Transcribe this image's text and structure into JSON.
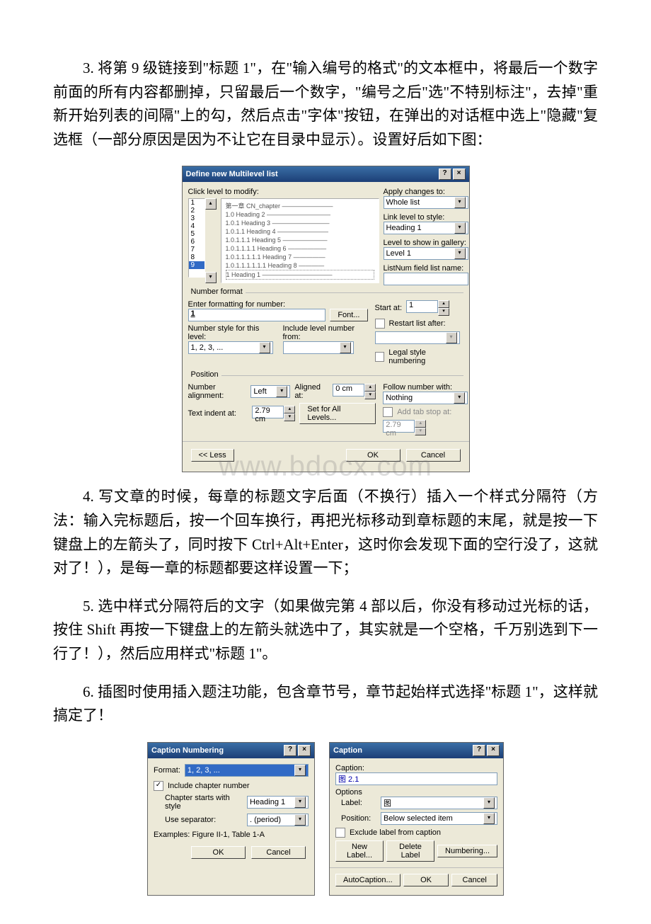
{
  "paragraphs": {
    "p3": "3. 将第 9 级链接到\"标题 1\"，在\"输入编号的格式\"的文本框中，将最后一个数字前面的所有内容都删掉，只留最后一个数字，\"编号之后\"选\"不特别标注\"，去掉\"重新开始列表的间隔\"上的勾，然后点击\"字体\"按钮，在弹出的对话框中选上\"隐藏\"复选框（一部分原因是因为不让它在目录中显示）。设置好后如下图：",
    "p4": "4. 写文章的时候，每章的标题文字后面（不换行）插入一个样式分隔符（方法：输入完标题后，按一个回车换行，再把光标移动到章标题的末尾，就是按一下键盘上的左箭头了，同时按下 Ctrl+Alt+Enter，这时你会发现下面的空行没了，这就对了！），是每一章的标题都要这样设置一下；",
    "p5": "5. 选中样式分隔符后的文字（如果做完第 4 部以后，你没有移动过光标的话，按住 Shift 再按一下键盘上的左箭头就选中了，其实就是一个空格，千万别选到下一行了！），然后应用样式\"标题 1\"。",
    "p6": "6. 插图时使用插入题注功能，包含章节号，章节起始样式选择\"标题 1\"，这样就搞定了！"
  },
  "watermark": "www.bdocx.com",
  "multilevel": {
    "title": "Define new Multilevel list",
    "click_level_label": "Click level to modify:",
    "levels": [
      "1",
      "2",
      "3",
      "4",
      "5",
      "6",
      "7",
      "8",
      "9"
    ],
    "selected_level": "9",
    "preview_lines": [
      "第一章 CN_chapter ————————",
      "1.0 Heading 2 ——————————",
      "1.0.1 Heading 3 —————————",
      "1.0.1.1 Heading 4 ————————",
      "1.0.1.1.1 Heading 5 ———————",
      "1.0.1.1.1.1 Heading 6 ——————",
      "1.0.1.1.1.1.1 Heading 7 —————",
      "1.0.1.1.1.1.1.1 Heading 8 ————",
      "1  Heading 1 ———————————"
    ],
    "apply_changes_label": "Apply changes to:",
    "apply_changes_value": "Whole list",
    "link_level_label": "Link level to style:",
    "link_level_value": "Heading 1",
    "level_gallery_label": "Level to show in gallery:",
    "level_gallery_value": "Level 1",
    "listnum_label": "ListNum field list name:",
    "listnum_value": "",
    "number_format_group": "Number format",
    "enter_formatting_label": "Enter formatting for number:",
    "enter_formatting_value": "1",
    "font_btn": "Font...",
    "number_style_label": "Number style for this level:",
    "number_style_value": "1, 2, 3, ...",
    "include_level_label": "Include level number from:",
    "include_level_value": "",
    "start_at_label": "Start at:",
    "start_at_value": "1",
    "restart_label": "Restart list after:",
    "restart_value": "",
    "legal_label": "Legal style numbering",
    "position_group": "Position",
    "number_alignment_label": "Number alignment:",
    "number_alignment_value": "Left",
    "aligned_at_label": "Aligned at:",
    "aligned_at_value": "0 cm",
    "text_indent_label": "Text indent at:",
    "text_indent_value": "2.79 cm",
    "set_all_btn": "Set for All Levels...",
    "follow_number_label": "Follow number with:",
    "follow_number_value": "Nothing",
    "add_tab_label": "Add tab stop at:",
    "add_tab_value": "2.79 cm",
    "less_btn": "<< Less",
    "ok_btn": "OK",
    "cancel_btn": "Cancel"
  },
  "caption_numbering": {
    "title": "Caption Numbering",
    "format_label": "Format:",
    "format_value": "1, 2, 3, ...",
    "include_chapter_label": "Include chapter number",
    "include_chapter_checked": "✓",
    "chapter_starts_label": "Chapter starts with style",
    "chapter_starts_value": "Heading 1",
    "separator_label": "Use separator:",
    "separator_value": ".   (period)",
    "examples_label": "Examples:  Figure II-1, Table 1-A",
    "ok_btn": "OK",
    "cancel_btn": "Cancel"
  },
  "caption": {
    "title": "Caption",
    "caption_label": "Caption:",
    "caption_value": "图 2.1",
    "options_label": "Options",
    "label_label": "Label:",
    "label_value": "图",
    "position_label": "Position:",
    "position_value": "Below selected item",
    "exclude_label": "Exclude label from caption",
    "new_label_btn": "New Label...",
    "delete_label_btn": "Delete Label",
    "numbering_btn": "Numbering...",
    "autocaption_btn": "AutoCaption...",
    "ok_btn": "OK",
    "cancel_btn": "Cancel"
  }
}
